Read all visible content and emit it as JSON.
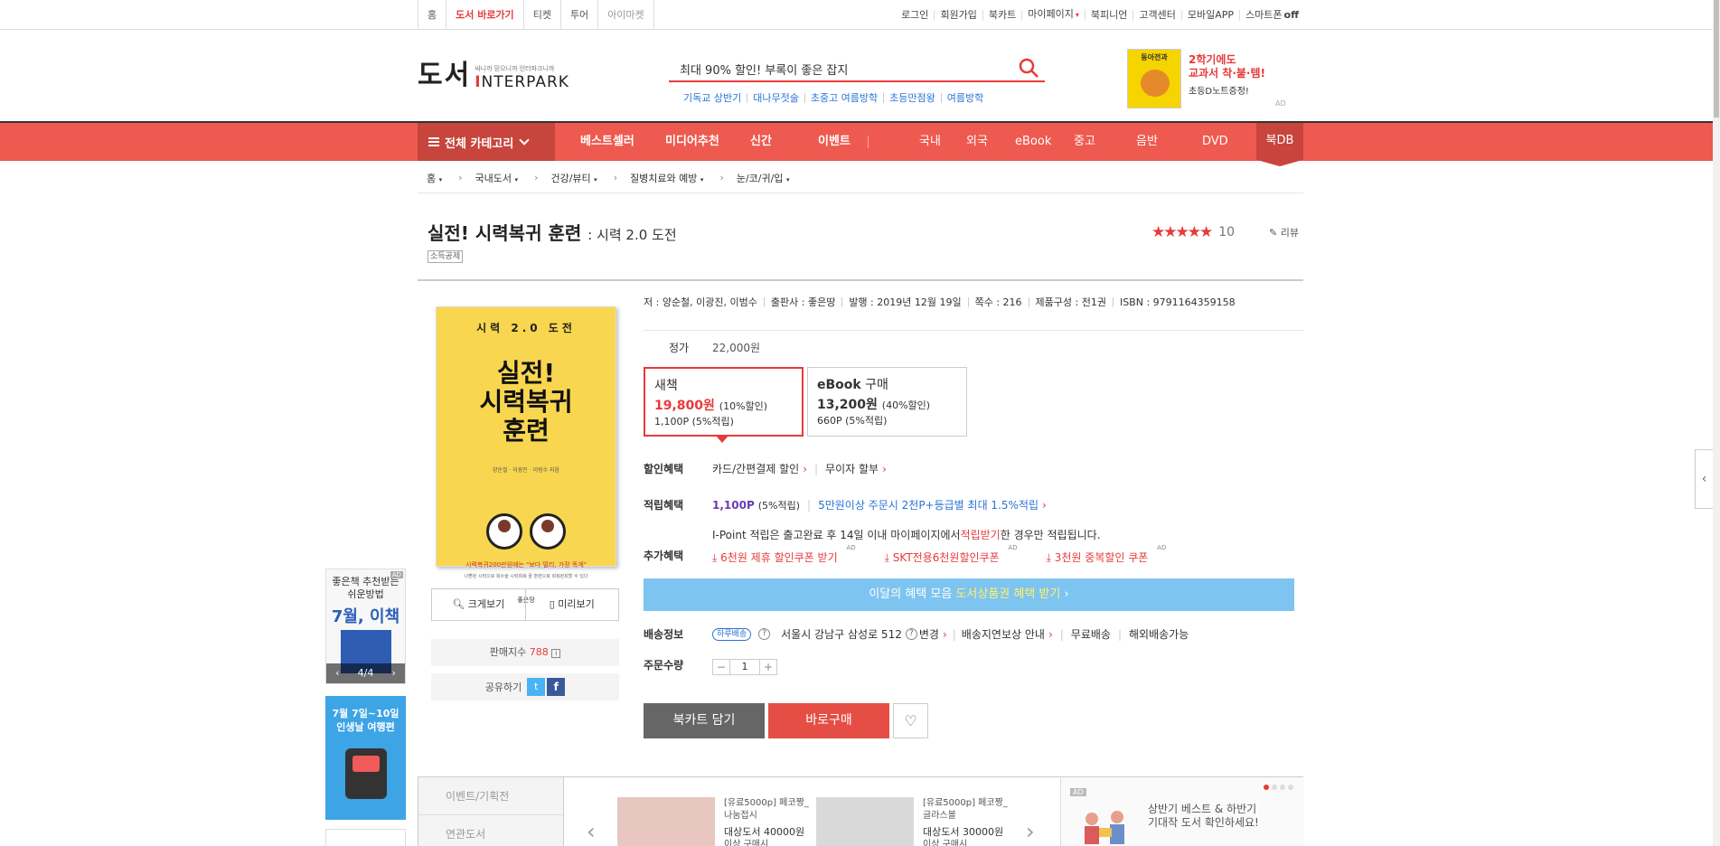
{
  "topbar": {
    "left": [
      "홈",
      "도서 바로가기",
      "티켓",
      "투어",
      "아이마켓"
    ],
    "right": [
      "로그인",
      "회원가입",
      "북카트",
      "마이페이지",
      "북피니언",
      "고객센터",
      "모바일APP",
      "스마트폰"
    ],
    "off_label": "off"
  },
  "header": {
    "logo_text": "도서",
    "slogan": "싸니까 믿으니까 인터파크니까",
    "brand_i": "I",
    "brand_rest": "NTERPARK",
    "search_text": "최대 90% 할인! 부록이 좋은 잡지",
    "keywords": [
      "기독교 상반기",
      "대나무젓술",
      "초중고 여름방학",
      "초등만점왕",
      "여름방학"
    ],
    "ad": {
      "img_text": "동아전과",
      "line1": "2학기에도",
      "line2": "교과서 착·붙·템!",
      "line3": "초등D노트증정!",
      "tag": "AD"
    }
  },
  "gnb": {
    "category": "전체 카테고리",
    "menus": [
      "베스트셀러",
      "미디어추천",
      "신간",
      "이벤트",
      "국내",
      "외국",
      "eBook",
      "중고",
      "음반",
      "DVD"
    ],
    "bookdb": "북DB"
  },
  "breadcrumb": [
    "홈",
    "국내도서",
    "건강/뷰티",
    "질병치료와 예방",
    "눈/코/귀/입"
  ],
  "product": {
    "title": "실전! 시력복귀 훈련",
    "subtitle": ": 시력 2.0 도전",
    "badge": "소득공제",
    "rating_stars": "★★★★★",
    "rating": "10",
    "review_label": "리뷰",
    "meta": [
      "저 : 양순철, 이광진, 이범수",
      "출판사 : 좋은땅",
      "발행 : 2019년 12월 19일",
      "쪽수 : 216",
      "제품구성 : 전1권",
      "ISBN : 9791164359158"
    ],
    "list_price_label": "정가",
    "list_price": "22,000원",
    "new": {
      "label": "새책",
      "price": "19,800원",
      "discount": "(10%할인)",
      "points": "1,100P (5%적립)"
    },
    "ebook": {
      "label": "eBook",
      "label2": "구매",
      "price": "13,200원",
      "discount": "(40%할인)",
      "points": "660P (5%적립)"
    },
    "discount_benefit": {
      "label": "할인혜택",
      "card": "카드/간편결제 할인",
      "installment": "무이자 할부"
    },
    "point_benefit": {
      "label": "적립혜택",
      "points": "1,100P",
      "rate": "(5%적립)",
      "extra": "5만원이상 주문시 2천P+등급별 최대 1.5%적립"
    },
    "ipoint": {
      "a": "I-Point 적립은 출고완료 후 14일 이내 마이페이지에서 ",
      "b": "적립받기",
      "c": "한 경우만 적립됩니다."
    },
    "extra_benefit": {
      "label": "추가혜택",
      "coupons": [
        "6천원 제휴 할인쿠폰 받기",
        "SKT전용6천원할인쿠폰",
        "3천원 중복할인 쿠폰"
      ],
      "ad": "AD"
    },
    "event_bar": {
      "a": "이달의 혜택 모음 ",
      "b": "도서상품권 혜택 받기"
    },
    "shipping": {
      "label": "배송정보",
      "tag": "하루배송",
      "address": "서울시 강남구 삼성로 512",
      "change": "변경",
      "compensation": "배송지연보상 안내",
      "free": "무료배송",
      "overseas": "해외배송가능"
    },
    "quantity": {
      "label": "주문수량",
      "value": "1"
    },
    "cart_button": "북카트 담기",
    "buy_button": "바로구매"
  },
  "cover": {
    "top": "시력 2.0 도전",
    "title1": "실전!",
    "title2": "시력복귀",
    "title3": "훈련",
    "authors": "양순철 · 이광진 · 이범수 지음",
    "tagline": "시력복귀200만원에는 \"보다 멀리, 가장 똑게\"",
    "desc": "나쁜된 시력으로 회수술 시력회복 꿈 훈련으로 회복된회할 수 있다",
    "publisher": "좋은땅"
  },
  "side_actions": {
    "zoom": "크게보기",
    "preview": "미리보기",
    "sales_label": "판매지수",
    "sales_value": "788",
    "share_label": "공유하기"
  },
  "left_banners": {
    "b1_line1": "좋은책 추천받는",
    "b1_line2": "쉬운방법",
    "b1_big": "7월, 이책",
    "b1_pager": "4/4",
    "b2_line1": "7월 7일~10일",
    "b2_line2": "인생날 여행편"
  },
  "bottom": {
    "side": [
      "이벤트/기획전",
      "연관도서"
    ],
    "items": [
      {
        "l1": "[유료5000p] 페코짱_",
        "l2": "나눔접시",
        "l3": "대상도서 40000원",
        "l4": "이상 구매시"
      },
      {
        "l1": "[유료5000p] 페코짱_",
        "l2": "글라스볼",
        "l3": "대상도서 30000원",
        "l4": "이상 구매시"
      }
    ],
    "ad_text1": "상반기 베스트 & 하반기",
    "ad_text2": "기대작 도서 확인하세요!",
    "ad_tag": "AD"
  },
  "colors": {
    "accent": "#ee5a4f",
    "price": "#e83a3a",
    "event": "#7ec4f0"
  }
}
